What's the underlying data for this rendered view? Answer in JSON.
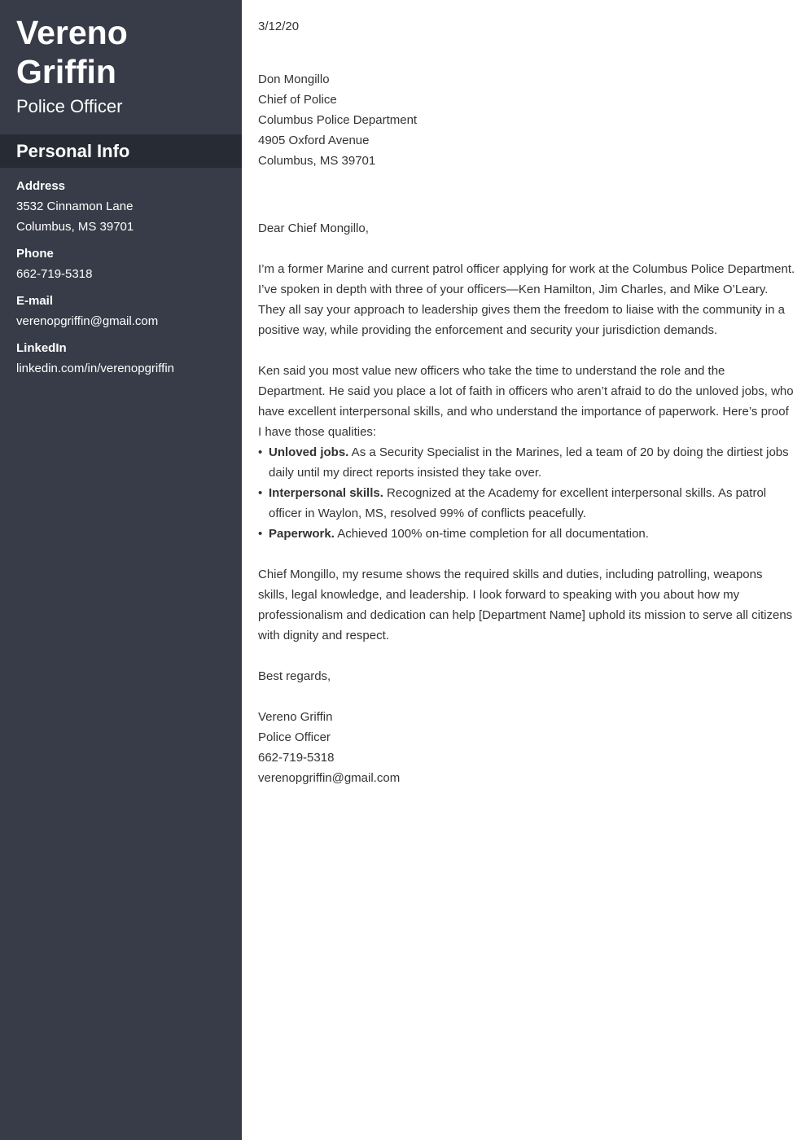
{
  "sidebar": {
    "name_first": "Vereno",
    "name_last": "Griffin",
    "title": "Police Officer",
    "section_title": "Personal Info",
    "address_label": "Address",
    "address_line1": "3532 Cinnamon Lane",
    "address_line2": "Columbus, MS 39701",
    "phone_label": "Phone",
    "phone": "662-719-5318",
    "email_label": "E-mail",
    "email": "verenopgriffin@gmail.com",
    "linkedin_label": "LinkedIn",
    "linkedin": "linkedin.com/in/verenopgriffin"
  },
  "letter": {
    "date": "3/12/20",
    "recipient": {
      "name": "Don Mongillo",
      "title": "Chief of Police",
      "organization": "Columbus Police Department",
      "street": "4905 Oxford Avenue",
      "city": "Columbus, MS 39701"
    },
    "salutation": "Dear Chief Mongillo,",
    "paragraph1": "I’m a former Marine and current patrol officer applying for work at the Columbus Police Department. I’ve spoken in depth with three of your officers—Ken Hamilton, Jim Charles, and Mike O’Leary. They all say your approach to leadership gives them the freedom to liaise with the community in a positive way, while providing the enforcement and security your jurisdiction demands.",
    "paragraph2": "Ken said you most value new officers who take the time to understand the role and the Department. He said you place a lot of faith in officers who aren’t afraid to do the unloved jobs, who have excellent interpersonal skills, and who understand the importance of paperwork. Here’s proof I have those qualities:",
    "bullets": [
      {
        "bold": "Unloved jobs.",
        "text": " As a Security Specialist in the Marines, led a team of 20 by doing the dirtiest jobs daily until my direct reports insisted they take over."
      },
      {
        "bold": "Interpersonal skills.",
        "text": " Recognized at the Academy for excellent interpersonal skills. As patrol officer in Waylon, MS, resolved 99% of conflicts peacefully."
      },
      {
        "bold": "Paperwork.",
        "text": " Achieved 100% on-time completion for all documentation."
      }
    ],
    "paragraph3": "Chief Mongillo, my resume shows the required skills and duties, including patrolling, weapons skills, legal knowledge, and leadership. I look forward to speaking with you about how my professionalism and dedication can help [Department Name] uphold its mission to serve all citizens with dignity and respect.",
    "closing": "Best regards,",
    "signature": {
      "name": "Vereno Griffin",
      "title": "Police Officer",
      "phone": "662-719-5318",
      "email": "verenopgriffin@gmail.com"
    }
  }
}
